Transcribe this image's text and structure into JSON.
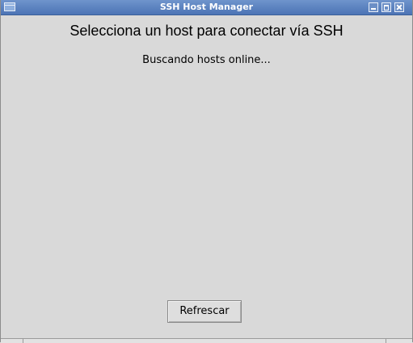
{
  "window": {
    "title": "SSH Host Manager",
    "titlebar_color": "#5a80be",
    "background_color": "#d9d9d9"
  },
  "titlebar_buttons": {
    "menu_icon": "window-menu-icon",
    "minimize_icon": "minimize-icon",
    "maximize_icon": "maximize-icon",
    "close_icon": "close-icon"
  },
  "main": {
    "heading": "Selecciona un host para conectar vía SSH",
    "status": "Buscando hosts online...",
    "refresh_label": "Refrescar"
  }
}
